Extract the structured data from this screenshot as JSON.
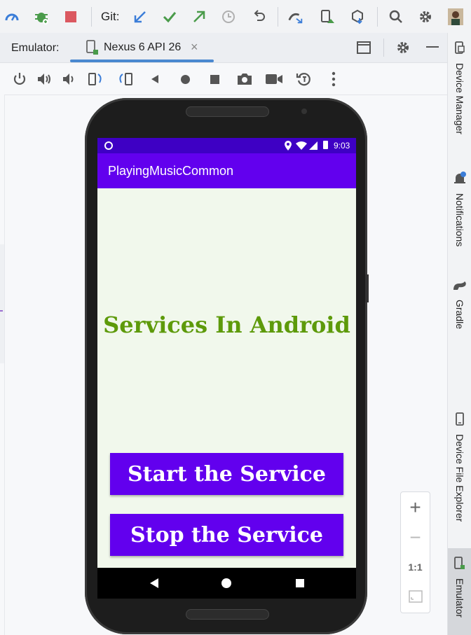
{
  "toolbar": {
    "git_label": "Git:",
    "icons": [
      "profiler-icon",
      "debug-icon",
      "stop-icon",
      "update-project-icon",
      "commit-icon",
      "push-icon",
      "history-icon",
      "rollback-icon",
      "device-sync-icon",
      "device-manager-icon",
      "sdk-manager-icon",
      "search-icon",
      "settings-icon",
      "avatar"
    ]
  },
  "emulator_tabs": {
    "label": "Emulator:",
    "device_tab": "Nexus 6 API 26",
    "close_glyph": "×"
  },
  "sidebar": {
    "device_manager": "Device Manager",
    "notifications": "Notifications",
    "gradle": "Gradle",
    "device_file_explorer": "Device File Explorer",
    "emulator": "Emulator"
  },
  "phone": {
    "time": "9:03",
    "app_title": "PlayingMusicCommon",
    "heading": "Services In Android",
    "start_button": "Start the Service",
    "stop_button": "Stop the Service"
  },
  "zoom": {
    "zoom_in": "+",
    "zoom_out": "−",
    "actual_size": "1:1"
  },
  "colors": {
    "status_bar": "#3e00c4",
    "app_bar": "#6200ee",
    "heading": "#5d9a0a",
    "screen_bg": "#f1f8ec",
    "tab_accent": "#4a88d0"
  }
}
